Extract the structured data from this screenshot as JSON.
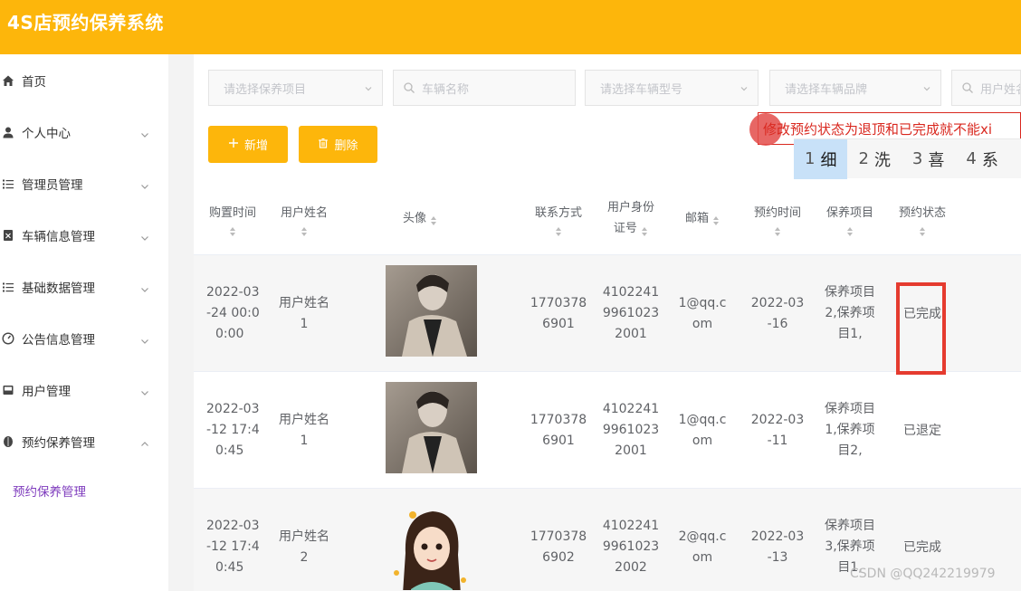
{
  "app": {
    "title": "4S店预约保养系统"
  },
  "sidebar": {
    "items": [
      {
        "label": "首页",
        "icon": "home-icon",
        "has_children": false
      },
      {
        "label": "个人中心",
        "icon": "user-icon",
        "has_children": true,
        "expanded": false
      },
      {
        "label": "管理员管理",
        "icon": "list-icon",
        "has_children": true,
        "expanded": false
      },
      {
        "label": "车辆信息管理",
        "icon": "document-icon",
        "has_children": true,
        "expanded": false
      },
      {
        "label": "基础数据管理",
        "icon": "list-icon",
        "has_children": true,
        "expanded": false
      },
      {
        "label": "公告信息管理",
        "icon": "gauge-icon",
        "has_children": true,
        "expanded": false
      },
      {
        "label": "用户管理",
        "icon": "tray-icon",
        "has_children": true,
        "expanded": false
      },
      {
        "label": "预约保养管理",
        "icon": "leaf-icon",
        "has_children": true,
        "expanded": true
      }
    ],
    "active_sub_item": "预约保养管理",
    "active_color": "#7e3bbd"
  },
  "filters": {
    "maintenance_item_placeholder": "请选择保养项目",
    "vehicle_name_placeholder": "车辆名称",
    "vehicle_model_placeholder": "请选择车辆型号",
    "vehicle_brand_placeholder": "请选择车辆品牌",
    "user_name_placeholder": "用户姓名"
  },
  "toolbar": {
    "add_label": "新增",
    "delete_label": "删除"
  },
  "ime": {
    "composition_text": "修改预约状态为退顶和已完成就不能xi",
    "candidates": [
      {
        "num": "1",
        "text": "细"
      },
      {
        "num": "2",
        "text": "洗"
      },
      {
        "num": "3",
        "text": "喜"
      },
      {
        "num": "4",
        "text": "系"
      }
    ]
  },
  "table": {
    "headers": {
      "purchase_time": "购置时间",
      "user_name": "用户姓名",
      "avatar": "头像",
      "contact": "联系方式",
      "id_number": [
        "用户身份",
        "证号"
      ],
      "email": "邮箱",
      "appointment_time": "预约时间",
      "maintenance_item": "保养项目",
      "status": "预约状态"
    },
    "rows": [
      {
        "purchase_time": [
          "2022-03",
          "-24 00:0",
          "0:00"
        ],
        "user_name": [
          "用户姓名",
          "1"
        ],
        "contact": [
          "1770378",
          "6901"
        ],
        "id_number": [
          "4102241",
          "9961023",
          "2001"
        ],
        "email": [
          "1@qq.c",
          "om"
        ],
        "appointment_time": [
          "2022-03",
          "-16"
        ],
        "maintenance_item": [
          "保养项目",
          "2,保养项",
          "目1,"
        ],
        "status": "已完成"
      },
      {
        "purchase_time": [
          "2022-03",
          "-12 17:4",
          "0:45"
        ],
        "user_name": [
          "用户姓名",
          "1"
        ],
        "contact": [
          "1770378",
          "6901"
        ],
        "id_number": [
          "4102241",
          "9961023",
          "2001"
        ],
        "email": [
          "1@qq.c",
          "om"
        ],
        "appointment_time": [
          "2022-03",
          "-11"
        ],
        "maintenance_item": [
          "保养项目",
          "1,保养项",
          "目2,"
        ],
        "status": "已退定"
      },
      {
        "purchase_time": [
          "2022-03",
          "-12 17:4",
          "0:45"
        ],
        "user_name": [
          "用户姓名",
          "2"
        ],
        "contact": [
          "1770378",
          "6902"
        ],
        "id_number": [
          "4102241",
          "9961023",
          "2002"
        ],
        "email": [
          "2@qq.c",
          "om"
        ],
        "appointment_time": [
          "2022-03",
          "-13"
        ],
        "maintenance_item": [
          "保养项目",
          "3,保养项",
          "目1,"
        ],
        "status": "已完成"
      }
    ]
  },
  "watermark": "CSDN @QQ242219979",
  "colors": {
    "brand": "#fdb60b",
    "highlight": "#e53b2f"
  }
}
